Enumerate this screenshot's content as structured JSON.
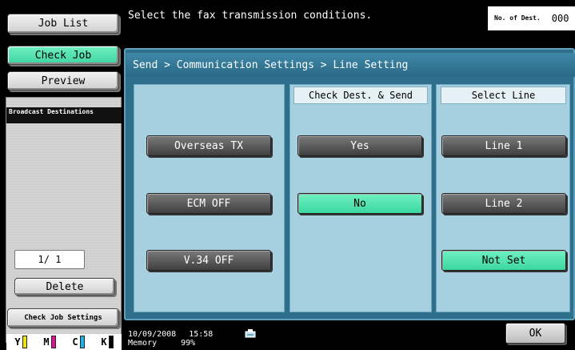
{
  "sidebar": {
    "job_list": "Job List",
    "check_job": "Check Job",
    "preview": "Preview",
    "broadcast_header": "Broadcast Destinations",
    "page_indicator": "1/  1",
    "delete": "Delete",
    "check_job_settings": "Check Job Settings",
    "toner": [
      {
        "label": "Y",
        "color": "#f2e600"
      },
      {
        "label": "M",
        "color": "#e0129a"
      },
      {
        "label": "C",
        "color": "#18b6e8"
      },
      {
        "label": "K",
        "color": "#000000"
      }
    ]
  },
  "header": {
    "message": "Select the fax transmission conditions.",
    "dest_label": "No. of Dest.",
    "dest_count": "000"
  },
  "main": {
    "breadcrumb": "Send > Communication Settings > Line Setting",
    "columns": {
      "check_dest_header": "Check Dest. & Send",
      "select_line_header": "Select Line"
    },
    "options": {
      "overseas_tx": "Overseas TX",
      "ecm_off": "ECM OFF",
      "v34_off": "V.34 OFF",
      "yes": "Yes",
      "no": "No",
      "line1": "Line 1",
      "line2": "Line 2",
      "not_set": "Not Set"
    }
  },
  "status": {
    "date": "10/09/2008",
    "time": "15:58",
    "memory_label": "Memory",
    "memory_value": "99%",
    "ok": "OK"
  }
}
